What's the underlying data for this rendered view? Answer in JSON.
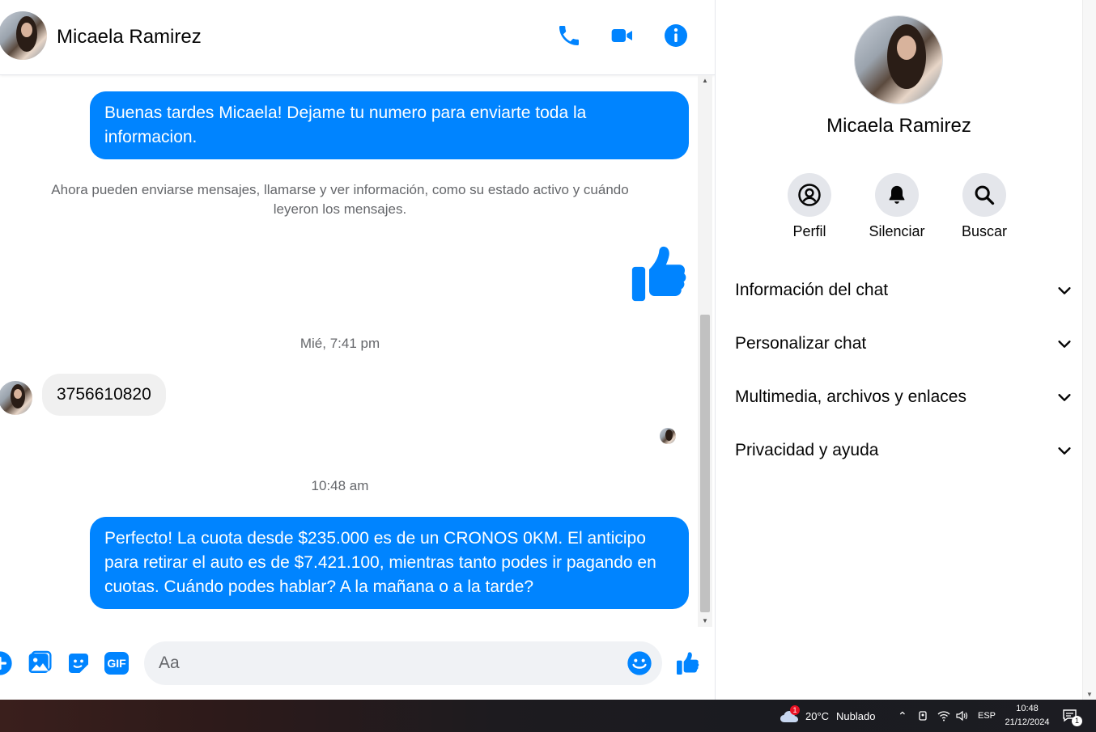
{
  "chat": {
    "contact_name": "Micaela Ramirez",
    "header_icons": [
      "phone-icon",
      "video-camera-icon",
      "info-icon"
    ],
    "messages": {
      "out1": "Buenas tardes Micaela! Dejame tu numero para enviarte toda la informacion.",
      "system_note": "Ahora pueden enviarse mensajes, llamarse y ver información, como su estado activo y cuándo leyeron los mensajes.",
      "time1": "Mié, 7:41 pm",
      "in1": "3756610820",
      "time2": "10:48 am",
      "out2": "Perfecto! La cuota desde $235.000 es de un CRONOS 0KM. El anticipo para retirar el auto es de $7.421.100, mientras tanto podes ir pagando en cuotas. Cuándo podes hablar? A la mañana o a la tarde?"
    },
    "composer": {
      "placeholder": "Aa",
      "icons": [
        "plus-icon",
        "image-icon",
        "sticker-icon",
        "gif-icon",
        "emoji-icon",
        "like-icon"
      ],
      "gif_label": "GIF"
    }
  },
  "info_panel": {
    "name": "Micaela Ramirez",
    "actions": [
      {
        "label": "Perfil",
        "icon": "profile-icon"
      },
      {
        "label": "Silenciar",
        "icon": "bell-icon"
      },
      {
        "label": "Buscar",
        "icon": "search-icon"
      }
    ],
    "sections": [
      "Información del chat",
      "Personalizar chat",
      "Multimedia, archivos y enlaces",
      "Privacidad y ayuda"
    ]
  },
  "taskbar": {
    "weather_temp": "20°C",
    "weather_desc": "Nublado",
    "weather_badge": "1",
    "language": "ESP",
    "time": "10:48",
    "date": "21/12/2024",
    "notification_count": "1"
  },
  "colors": {
    "accent": "#0084ff",
    "incoming_bubble": "#f0f0f0",
    "muted_text": "#65676b"
  }
}
